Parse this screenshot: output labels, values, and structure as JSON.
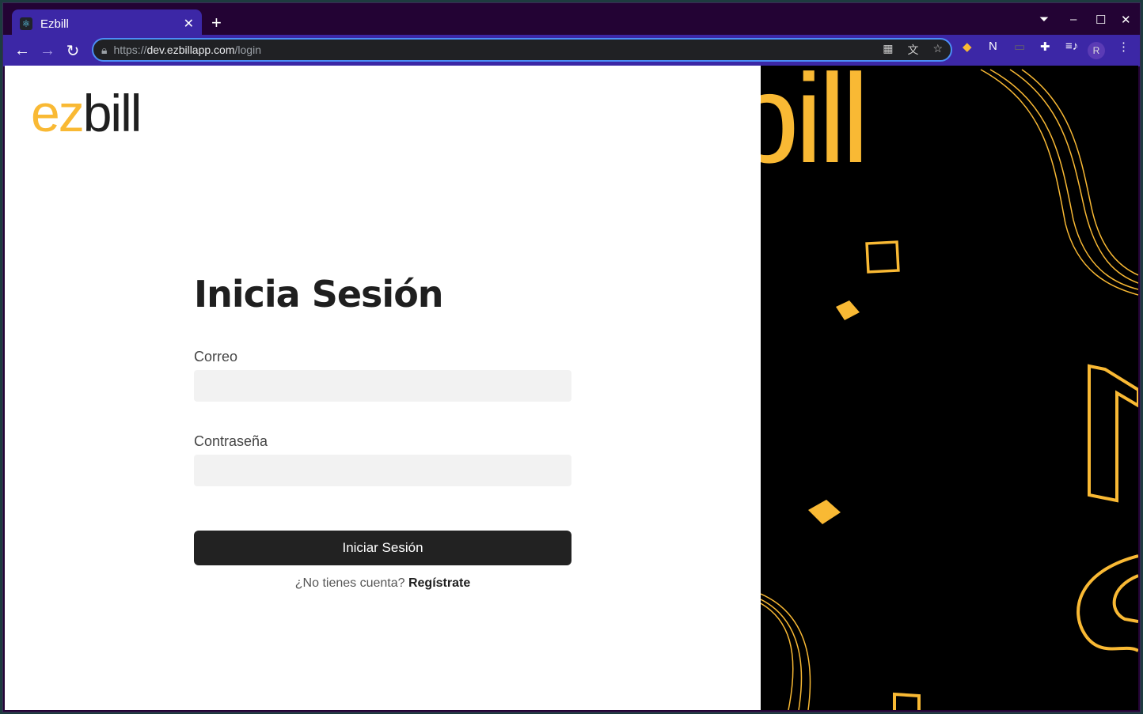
{
  "browser": {
    "tab_title": "Ezbill",
    "url_scheme": "https://",
    "url_host": "dev.ezbillapp.com",
    "url_path": "/login",
    "profile_initial": "R"
  },
  "page": {
    "logo_ez": "ez",
    "logo_bill": "bill",
    "title": "Inicia Sesión",
    "email_label": "Correo",
    "email_value": "",
    "password_label": "Contraseña",
    "password_value": "",
    "submit_label": "Iniciar Sesión",
    "signup_prompt": "¿No tienes cuenta?",
    "signup_link": "Regístrate"
  },
  "decor": {
    "bg_logo_text": "bill"
  },
  "colors": {
    "accent": "#f9b934",
    "button": "#222222",
    "browser_toolbar": "#3c27a6"
  }
}
